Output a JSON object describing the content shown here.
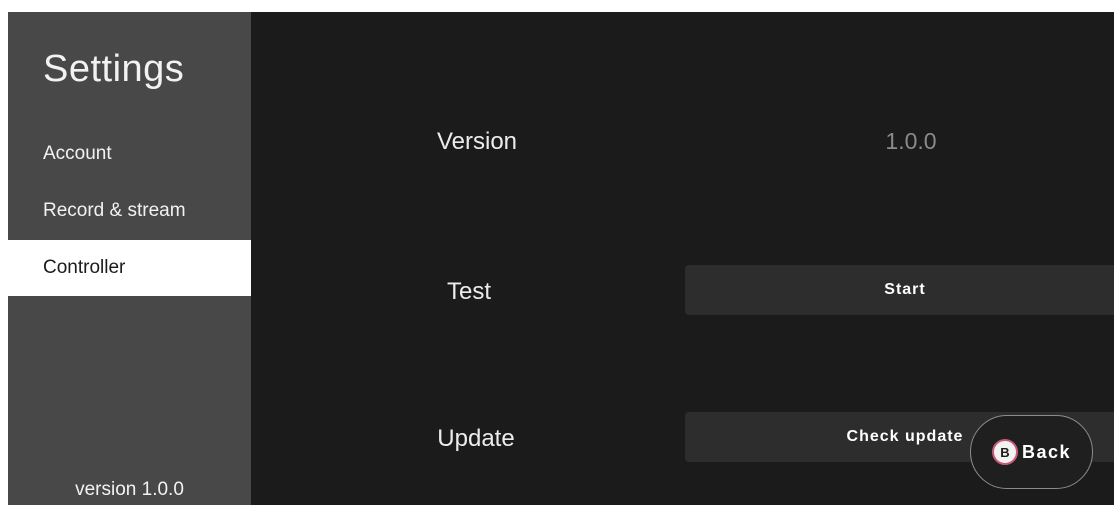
{
  "sidebar": {
    "title": "Settings",
    "items": [
      {
        "label": "Account"
      },
      {
        "label": "Record & stream"
      },
      {
        "label": "Controller"
      }
    ],
    "version": "version 1.0.0"
  },
  "main": {
    "version_label": "Version",
    "version_value": "1.0.0",
    "test_label": "Test",
    "start_button": "Start",
    "update_label": "Update",
    "check_update_button": "Check update"
  },
  "back_button": {
    "key": "B",
    "label": "Back"
  }
}
